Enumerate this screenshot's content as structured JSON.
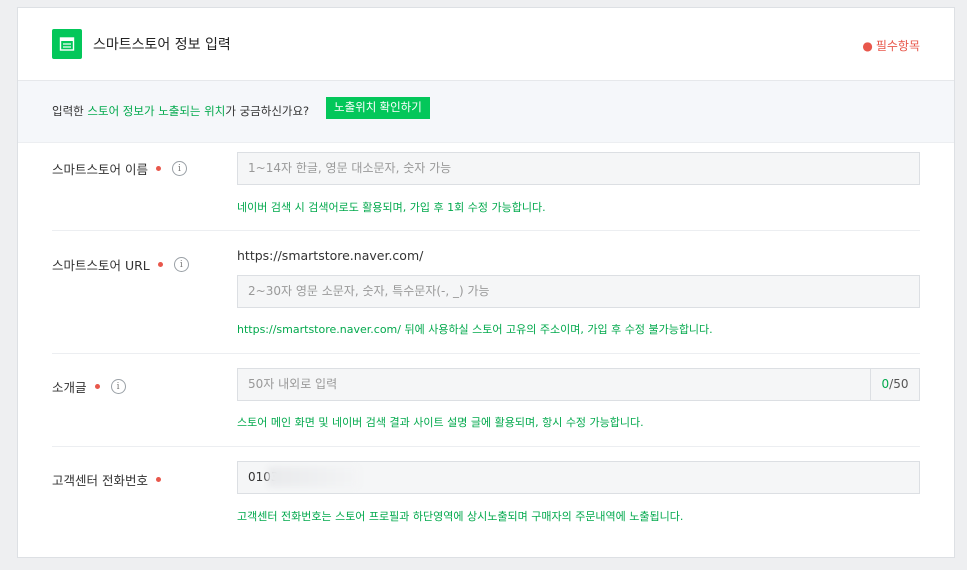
{
  "header": {
    "title": "스마트스토어 정보 입력",
    "required_note": "필수항목",
    "icon": "store-icon"
  },
  "notice": {
    "text_prefix": "입력한 ",
    "text_green": "스토어 정보가 노출되는 위치",
    "text_suffix": "가 궁금하신가요?",
    "button": "노출위치 확인하기"
  },
  "fields": {
    "name": {
      "label": "스마트스토어 이름",
      "placeholder": "1~14자 한글, 영문 대소문자, 숫자 가능",
      "help": "네이버 검색 시 검색어로도 활용되며, 가입 후 1회 수정 가능합니다."
    },
    "url": {
      "label": "스마트스토어 URL",
      "prefix": "https://smartstore.naver.com/",
      "placeholder": "2~30자 영문 소문자, 숫자, 특수문자(-, _) 가능",
      "help": "https://smartstore.naver.com/ 뒤에 사용하실 스토어 고유의 주소이며, 가입 후 수정 불가능합니다."
    },
    "intro": {
      "label": "소개글",
      "placeholder": "50자 내외로 입력",
      "counter_current": "0",
      "counter_max": "/50",
      "help": "스토어 메인 화면 및 네이버 검색 결과 사이트 설명 글에 활용되며, 항시 수정 가능합니다."
    },
    "phone": {
      "label": "고객센터 전화번호",
      "value": "0103",
      "help": "고객센터 전화번호는 스토어 프로필과 하단영역에 상시노출되며 구매자의 주문내역에 노출됩니다."
    }
  },
  "colors": {
    "accent": "#03c75a",
    "required": "#e8574b"
  }
}
